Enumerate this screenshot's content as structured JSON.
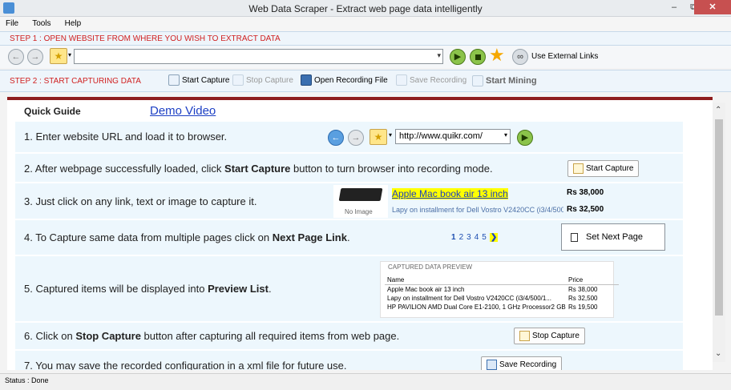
{
  "window": {
    "title": "Web Data Scraper -  Extract web page data intelligently",
    "minimize": "–",
    "restore": "⧉",
    "close": "✕"
  },
  "menu": [
    "File",
    "Tools",
    "Help"
  ],
  "step1": "STEP 1 : OPEN WEBSITE FROM WHERE YOU WISH TO EXTRACT DATA",
  "address": {
    "value": "",
    "use_external_links": "Use External Links"
  },
  "step2": "STEP 2 : START CAPTURING DATA",
  "toolbar": {
    "start_capture": "Start Capture",
    "stop_capture": "Stop Capture",
    "open_recording": "Open Recording File",
    "save_recording": "Save Recording",
    "start_mining": "Start Mining"
  },
  "guide": {
    "tab_quick": "Quick Guide",
    "tab_demo": "Demo Video",
    "step1_text": "1. Enter website URL and load it to browser.",
    "step1_url": "http://www.quikr.com/",
    "step2_text_a": "2. After webpage successfully loaded, click ",
    "step2_bold": "Start Capture",
    "step2_text_b": " button to turn browser into recording mode.",
    "step2_btn": "Start Capture",
    "step3_text": "3. Just click on any link, text or image to capture it.",
    "step3_noimage": "No Image",
    "step3_link": "Apple Mac book air 13 inch",
    "step3_sub": "Lapy on installment for Dell Vostro V2420CC (i3/4/500/1...",
    "step3_price1": "Rs 38,000",
    "step3_price2": "Rs 32,500",
    "step4_text_a": "4. To Capture same data from multiple pages click on ",
    "step4_bold": "Next Page Link",
    "step4_text_b": ".",
    "step4_pages": [
      "1",
      "2",
      "3",
      "4",
      "5"
    ],
    "step4_next": "❯",
    "step4_btn": "Set Next Page",
    "step5_text_a": "5. Captured items will be displayed into ",
    "step5_bold": "Preview List",
    "step5_text_b": ".",
    "preview_title": "CAPTURED DATA PREVIEW",
    "preview_headers": [
      "Name",
      "Price"
    ],
    "preview_rows": [
      [
        "Apple Mac book air 13 inch",
        "Rs 38,000"
      ],
      [
        "Lapy on installment for Dell Vostro V2420CC (i3/4/500/1...",
        "Rs 32,500"
      ],
      [
        "HP PAVILION AMD Dual Core E1-2100, 1 GHz Processor2 GB ...",
        "Rs 19,500"
      ]
    ],
    "step6_text_a": "6. Click on ",
    "step6_bold": "Stop Capture",
    "step6_text_b": " button after capturing all required items from web page.",
    "step6_btn": "Stop Capture",
    "step7_text": "7. You may save the recorded configuration in a xml file for future use.",
    "step7_btn": "Save Recording"
  },
  "status": "Status :  Done",
  "colors": {
    "step_text": "#d02020",
    "accent_line": "#8e1c1c",
    "row_bg": "#edf7fd",
    "highlight": "#ffff00"
  }
}
